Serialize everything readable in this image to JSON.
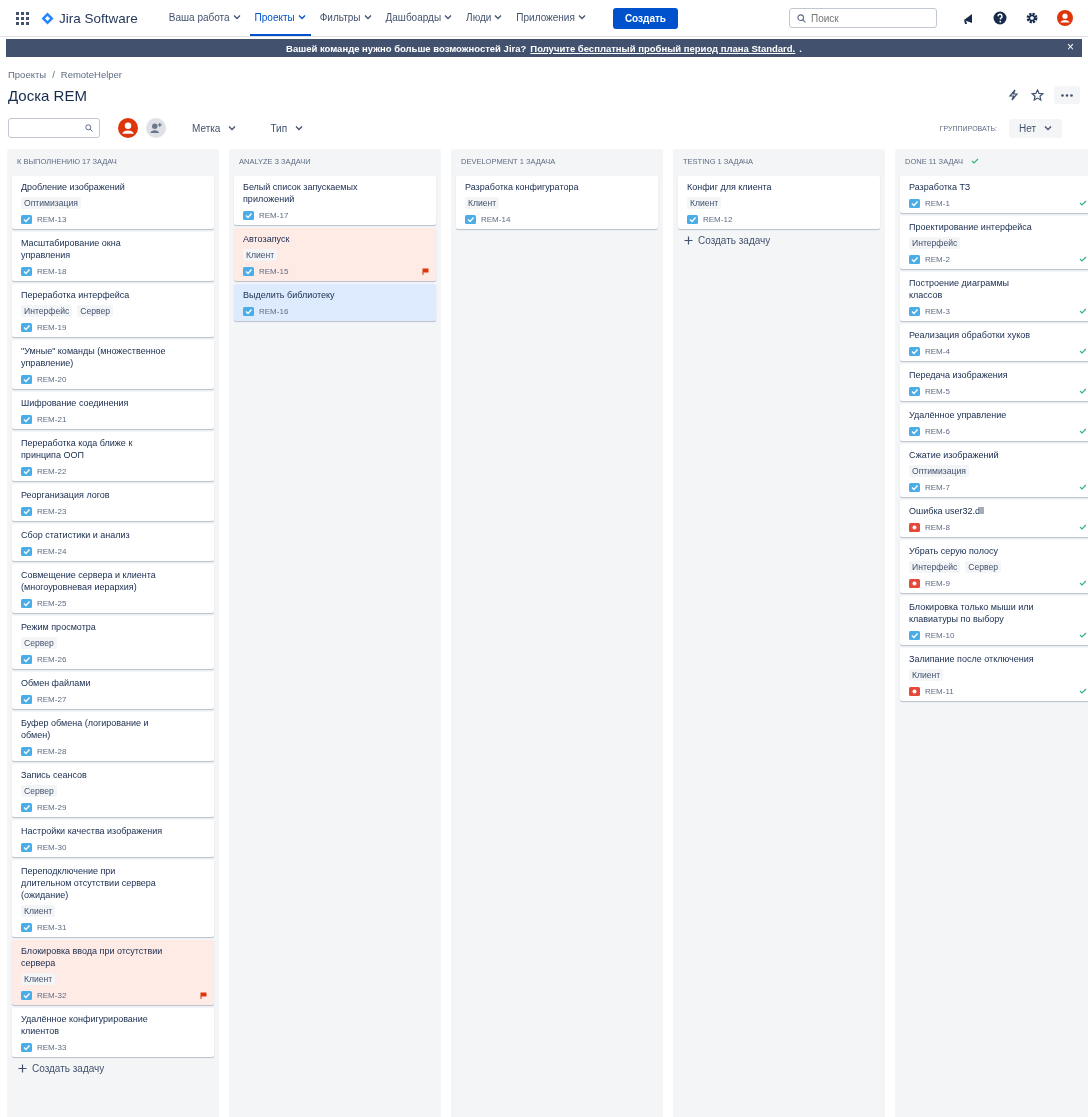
{
  "nav": {
    "product": "Jira Software",
    "menus": [
      {
        "label": "Ваша работа",
        "selected": false
      },
      {
        "label": "Проекты",
        "selected": true
      },
      {
        "label": "Фильтры",
        "selected": false
      },
      {
        "label": "Дашбоарды",
        "selected": false
      },
      {
        "label": "Люди",
        "selected": false
      },
      {
        "label": "Приложения",
        "selected": false
      }
    ],
    "create": "Создать",
    "search": {
      "placeholder": "Поиск"
    }
  },
  "banner": {
    "text": "Вашей команде нужно больше возможностей Jira?",
    "link": "Получите бесплатный пробный период плана Standard.",
    "tail": ".",
    "close": "×"
  },
  "breadcrumbs": [
    "Проекты",
    "/",
    "RemoteHelper"
  ],
  "title": "Доска REM",
  "filters": [
    "Метка",
    "Тип"
  ],
  "group_by": {
    "label": "ГРУППИРОВАТЬ:",
    "value": "Нет"
  },
  "columns": [
    {
      "title": "К ВЫПОЛНЕНИЮ 17 ЗАДАЧ",
      "done": false,
      "create": "Создать задачу",
      "cards": [
        {
          "title": "Дробление изображений",
          "labels": [
            "Оптимизация"
          ],
          "key": "REM-13",
          "kind": "story",
          "flagged": false,
          "selected": false,
          "done": false
        },
        {
          "title": "Масштабирование окна управления",
          "key": "REM-18",
          "kind": "story",
          "flagged": false,
          "selected": false,
          "done": false
        },
        {
          "title": "Переработка интерфейса",
          "labels": [
            "Интерфейс",
            "Сервер"
          ],
          "key": "REM-19",
          "kind": "story",
          "flagged": false,
          "selected": false,
          "done": false
        },
        {
          "title": "\"Умные\" команды (множественное управление)",
          "key": "REM-20",
          "kind": "story",
          "flagged": false,
          "selected": false,
          "done": false
        },
        {
          "title": "Шифрование соединения",
          "key": "REM-21",
          "kind": "story",
          "flagged": false,
          "selected": false,
          "done": false
        },
        {
          "title": "Переработка кода ближе к принципа ООП",
          "key": "REM-22",
          "kind": "story",
          "flagged": false,
          "selected": false,
          "done": false
        },
        {
          "title": "Реорганизация логов",
          "key": "REM-23",
          "kind": "story",
          "flagged": false,
          "selected": false,
          "done": false
        },
        {
          "title": "Сбор статистики и анализ",
          "key": "REM-24",
          "kind": "story",
          "flagged": false,
          "selected": false,
          "done": false
        },
        {
          "title": "Совмещение сервера и клиента (многоуровневая иерархия)",
          "key": "REM-25",
          "kind": "story",
          "flagged": false,
          "selected": false,
          "done": false
        },
        {
          "title": "Режим просмотра",
          "labels": [
            "Сервер"
          ],
          "key": "REM-26",
          "kind": "story",
          "flagged": false,
          "selected": false,
          "done": false
        },
        {
          "title": "Обмен файлами",
          "key": "REM-27",
          "kind": "story",
          "flagged": false,
          "selected": false,
          "done": false
        },
        {
          "title": "Буфер обмена (логирование и обмен)",
          "key": "REM-28",
          "kind": "story",
          "flagged": false,
          "selected": false,
          "done": false
        },
        {
          "title": "Запись сеансов",
          "labels": [
            "Сервер"
          ],
          "key": "REM-29",
          "kind": "story",
          "flagged": false,
          "selected": false,
          "done": false
        },
        {
          "title": "Настройки качества изображения",
          "key": "REM-30",
          "kind": "story",
          "flagged": false,
          "selected": false,
          "done": false
        },
        {
          "title": "Переподключение при длительном отсутствии сервера (ожидание)",
          "labels": [
            "Клиент"
          ],
          "key": "REM-31",
          "kind": "story",
          "flagged": false,
          "selected": false,
          "done": false
        },
        {
          "title": "Блокировка ввода при отсутствии сервера",
          "labels": [
            "Клиент"
          ],
          "key": "REM-32",
          "kind": "story",
          "flagged": true,
          "selected": false,
          "done": false
        },
        {
          "title": "Удалённое конфигурирование клиентов",
          "key": "REM-33",
          "kind": "story",
          "flagged": false,
          "selected": false,
          "done": false
        }
      ]
    },
    {
      "title": "ANALYZE 3 ЗАДАЧИ",
      "done": false,
      "cards": [
        {
          "title": "Белый список запускаемых приложений",
          "key": "REM-17",
          "kind": "story",
          "flagged": false,
          "selected": false,
          "done": false
        },
        {
          "title": "Автозапуск",
          "labels": [
            "Клиент"
          ],
          "key": "REM-15",
          "kind": "story",
          "flagged": true,
          "selected": false,
          "done": false
        },
        {
          "title": "Выделить библиотеку",
          "key": "REM-16",
          "kind": "story",
          "flagged": false,
          "selected": true,
          "done": false
        }
      ]
    },
    {
      "title": "DEVELOPMENT 1 ЗАДАЧА",
      "done": false,
      "cards": [
        {
          "title": "Разработка конфигуратора",
          "labels": [
            "Клиент"
          ],
          "key": "REM-14",
          "kind": "story",
          "flagged": false,
          "selected": false,
          "done": false
        }
      ]
    },
    {
      "title": "TESTING 1 ЗАДАЧА",
      "done": false,
      "create": "Создать задачу",
      "cards": [
        {
          "title": "Конфиг для клиента",
          "labels": [
            "Клиент"
          ],
          "key": "REM-12",
          "kind": "story",
          "flagged": false,
          "selected": false,
          "done": false
        }
      ]
    },
    {
      "title": "DONE 11 ЗАДАЧ",
      "done": true,
      "cards": [
        {
          "title": "Разработка ТЗ",
          "key": "REM-1",
          "kind": "story",
          "flagged": false,
          "selected": false,
          "done": true
        },
        {
          "title": "Проектирование интерфейса",
          "labels": [
            "Интерфейс"
          ],
          "key": "REM-2",
          "kind": "story",
          "flagged": false,
          "selected": false,
          "done": true
        },
        {
          "title": "Построение диаграммы классов",
          "key": "REM-3",
          "kind": "story",
          "flagged": false,
          "selected": false,
          "done": true
        },
        {
          "title": "Реализация обработки хуков",
          "key": "REM-4",
          "kind": "story",
          "flagged": false,
          "selected": false,
          "done": true
        },
        {
          "title": "Передача изображения",
          "key": "REM-5",
          "kind": "story",
          "flagged": false,
          "selected": false,
          "done": true
        },
        {
          "title": "Удалённое управление",
          "key": "REM-6",
          "kind": "story",
          "flagged": false,
          "selected": false,
          "done": true
        },
        {
          "title": "Сжатие изображений",
          "labels": [
            "Оптимизация"
          ],
          "key": "REM-7",
          "kind": "story",
          "flagged": false,
          "selected": false,
          "done": true
        },
        {
          "title": "Ошибка user32.dll",
          "key": "REM-8",
          "kind": "bug",
          "flagged": false,
          "selected": false,
          "done": true
        },
        {
          "title": "Убрать серую полосу",
          "labels": [
            "Интерфейс",
            "Сервер"
          ],
          "key": "REM-9",
          "kind": "bug",
          "flagged": false,
          "selected": false,
          "done": true
        },
        {
          "title": "Блокировка только мыши или клавиатуры по выбору",
          "key": "REM-10",
          "kind": "story",
          "flagged": false,
          "selected": false,
          "done": true
        },
        {
          "title": "Залипание после отключения",
          "labels": [
            "Клиент"
          ],
          "key": "REM-11",
          "kind": "bug",
          "flagged": false,
          "selected": false,
          "done": true
        }
      ]
    }
  ]
}
